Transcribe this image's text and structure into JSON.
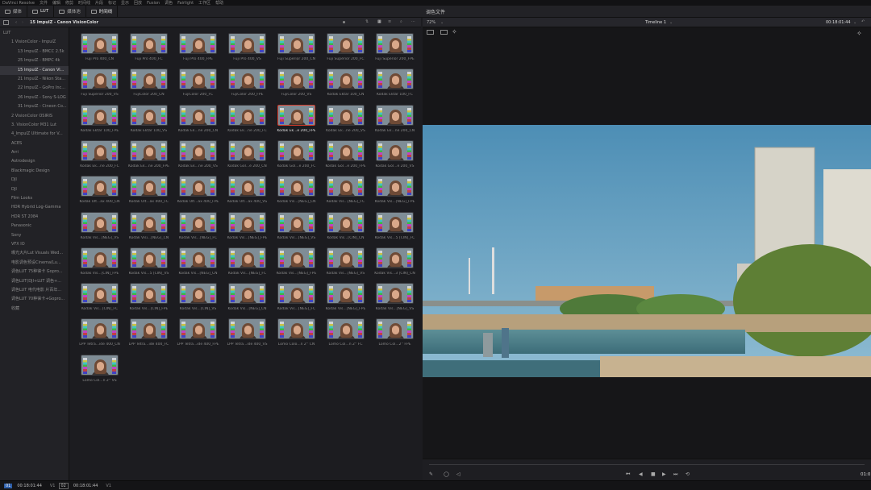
{
  "menubar": [
    "DaVinci Resolve",
    "文件",
    "编辑",
    "修剪",
    "时间线",
    "片段",
    "标记",
    "显示",
    "回放",
    "Fusion",
    "调色",
    "Fairlight",
    "工作区",
    "帮助"
  ],
  "toolbar": {
    "buttons": [
      {
        "label": "媒体",
        "icon": "media-icon"
      },
      {
        "label": "LUT",
        "icon": "lut-icon"
      },
      {
        "label": "媒体池",
        "icon": "media-pool-icon"
      },
      {
        "label": "时间线",
        "icon": "timeline-icon"
      }
    ],
    "title": "调色文件"
  },
  "browser": {
    "path": "15 ImpulZ - Canon VisionColor"
  },
  "viewer": {
    "zoom": "72%",
    "timeline": "Timeline 1",
    "timecode": "00:18:01:44"
  },
  "sidebar": {
    "items": [
      "LUT",
      "1 VisionColor - ImpulZ",
      "13 ImpulZ - BMCC 2.5k",
      "25 ImpulZ - BMPC 4k",
      "15 ImpulZ - Canon Vi...",
      "21 ImpulZ - Nikon Sta...",
      "22 ImpulZ - GoPro Inc...",
      "26 ImpulZ - Sony S-LOG",
      "31 ImpulZ - Cineon Co...",
      "2 VisionColor OSIRIS",
      "3. VisionColor M31 Lut",
      "4_ImpulZ Ultimate for V...",
      "ACES",
      "Arri",
      "Astrodesign",
      "Blackmagic Design",
      "DJI",
      "DJI",
      "Film Looks",
      "HDR Hybrid Log-Gamma",
      "HDR ST 2084",
      "Panasonic",
      "Sony",
      "VFX IO",
      "曝光大片Lut Visuals Wed...",
      "电影调色预设Cinema(Lu...",
      "调色LUT 75种徕卡 Gopro...",
      "调色LUT(DJI+LUT 调色+...",
      "调色LUT 电代电影 片百年...",
      "调色LUT 70种徕卡+Gopro...",
      "收藏"
    ],
    "selected": 4
  },
  "thumbnails": [
    "Fuji Pro 400_CN",
    "Fuji Pro 400_FC",
    "Fuji Pro 400_FPE",
    "Fuji Pro 400_VS",
    "Fuji Superior 200_CN",
    "Fuji Superior 200_FC",
    "Fuji Superior 200_FPE",
    "Fuji Superior 200_VS",
    "FujiColor 200_CN",
    "FujiColor 200_FC",
    "FujiColor 200_FPE",
    "FujiColor 200_VS",
    "Kodak Ektar 100_CN",
    "Kodak Ektar 100_FC",
    "Kodak Ektar 100_FPE",
    "Kodak Ektar 100_VS",
    "Kodak Ek...ne 200_CN",
    "Kodak Ek...ne 200_FC",
    "Kodak Ek...e 200_FPE",
    "Kodak Ek...ne 200_VS",
    "Kodak Ek...ne 200_CN",
    "Kodak Ek...ne 200_FC",
    "Kodak Ek...ne 200_FPE",
    "Kodak Ek...ne 200_VS",
    "Kodak Gol...e 200_CN",
    "Kodak Gol...e 200_FC",
    "Kodak Gol...e 200_FPE",
    "Kodak Gol...e 200_VS",
    "Kodak Ult...ax 400_CN",
    "Kodak Ult...ax 400_FC",
    "Kodak Ult...ax 400_FPE",
    "Kodak Ult...ax 400_VS",
    "Kodak Vis...[NEG]_CN",
    "Kodak Vis...[NEG]_FC",
    "Kodak Vis...[NEG]_FPE",
    "Kodak Vis...[NEG]_VS",
    "Kodak Visi...[NEG]_CN",
    "Kodak Vis...[NEG]_FC",
    "Kodak Vis...[NEG]_FPE",
    "Kodak Vis...[NEG]_VS",
    "Kodak Vis...[CIN]_CN",
    "Kodak Vis...5 [CIN]_FC",
    "Kodak Vis...[CIN]_FPE",
    "Kodak Vis...5 [CIN]_VS",
    "Kodak Vis...[NEG]_CN",
    "Kodak Vis...[NEG]_FC",
    "Kodak Vis...[NEG]_FPE",
    "Kodak Vis...[NEG]_VS",
    "Kodak Vis...3 [CIN]_CN",
    "Kodak Vis...[CIN]_FC",
    "Kodak Vis...[CIN]_FPE",
    "Kodak Vis...[CIN]_VS",
    "Kodak Vis...[NEG]_CN",
    "Kodak Vis...[NEG]_FC",
    "Kodak Vis...[NEG]_FPE",
    "Kodak Vis...[NEG]_VS",
    "LPP Tetra...ide 400_CN",
    "LPP Tetra...ide 400_FC",
    "LPP Tetra...ide 400_FPE",
    "LPP Tetra...ide 400_VS",
    "Lomo Colo...n 2'' CN",
    "Lomo Col...n 2'' FC",
    "Lomo Col...2'' FPE",
    "Lomo Col...n 2'' VS"
  ],
  "selected_thumbnail": 18,
  "transport": {
    "timecode_end": "01:0",
    "icons": [
      "skip-back-icon",
      "rewind-icon",
      "stop-icon",
      "play-icon",
      "skip-forward-icon",
      "loop-icon"
    ]
  },
  "statusbar": {
    "track1": "01",
    "tc1": "00:18:01:44",
    "v1": "V1",
    "track2": "02",
    "tc2": "00:18:01:44",
    "v2": "V1"
  },
  "colors": {
    "accent": "#d23a2a",
    "panel": "#222226",
    "bg": "#1c1c20",
    "selection": "#34343a"
  }
}
